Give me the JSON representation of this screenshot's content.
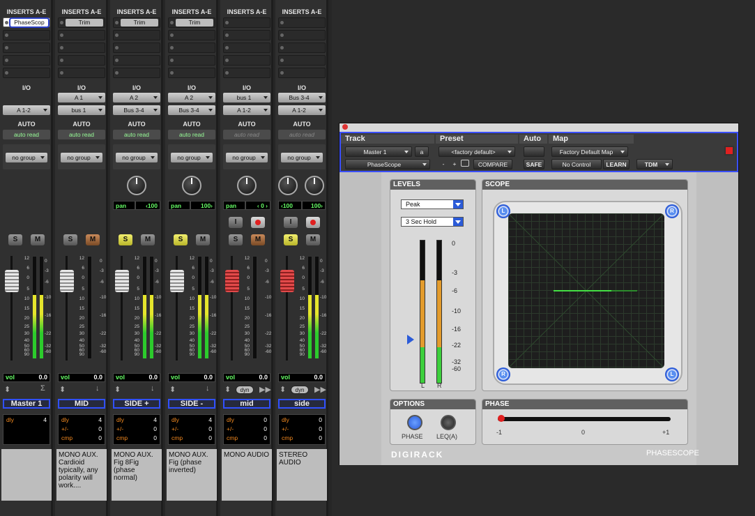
{
  "mixer": {
    "inserts_header": "INSERTS A-E",
    "io_header": "I/O",
    "auto_header": "AUTO",
    "vol_label": "vol",
    "dly_label": "dly",
    "pm_label": "+/-",
    "cmp_label": "cmp",
    "strips": [
      {
        "insert": "PhaseScop",
        "io_in": "",
        "io_out": "A 1-2",
        "auto": "auto read",
        "group": "no group",
        "vol": "0.0",
        "name": "Master 1",
        "dly": "4",
        "pm": "",
        "cmp": "",
        "comment": ""
      },
      {
        "insert": "Trim",
        "io_in": "A 1",
        "io_out": "bus 1",
        "auto": "auto read",
        "group": "no group",
        "vol": "0.0",
        "name": "MID",
        "dly": "4",
        "pm": "0",
        "cmp": "0",
        "comment": "MONO AUX. Cardioid typically, any polarity will work...."
      },
      {
        "insert": "Trim",
        "io_in": "A 2",
        "io_out": "Bus 3-4",
        "auto": "auto read",
        "group": "no group",
        "vol": "0.0",
        "name": "SIDE +",
        "pan": "pan",
        "pan_val": "‹100",
        "dly": "4",
        "pm": "0",
        "cmp": "0",
        "comment": "MONO AUX. Fig 8Fig (phase normal)"
      },
      {
        "insert": "Trim",
        "io_in": "A 2",
        "io_out": "Bus 3-4",
        "auto": "auto read",
        "group": "no group",
        "vol": "0.0",
        "name": "SIDE -",
        "pan": "pan",
        "pan_val": "100›",
        "dly": "4",
        "pm": "0",
        "cmp": "0",
        "comment": "MONO AUX. Fig (phase inverted)"
      },
      {
        "insert": "",
        "io_in": "bus 1",
        "io_out": "A 1-2",
        "auto": "auto read",
        "group": "no group",
        "vol": "0.0",
        "name": "mid",
        "pan": "pan",
        "pan_val": "‹ 0 ›",
        "dyn": "dyn",
        "dly": "0",
        "pm": "0",
        "cmp": "0",
        "comment": "MONO AUDIO"
      },
      {
        "insert": "",
        "io_in": "Bus 3-4",
        "io_out": "A 1-2",
        "auto": "auto read",
        "group": "no group",
        "vol": "0.0",
        "name": "side",
        "pan_l": "‹100",
        "pan_r": "100›",
        "dyn": "dyn",
        "dly": "0",
        "pm": "0",
        "cmp": "0",
        "comment": "STEREO AUDIO"
      }
    ],
    "fader_scale": [
      "12",
      "6",
      "0",
      "5",
      "10",
      "15",
      "20",
      "25",
      "30",
      "40",
      "50",
      "60",
      "90"
    ],
    "meter_scale": [
      "0",
      "-3",
      "-6",
      "-10",
      "-16",
      "-22",
      "-32",
      "-60"
    ]
  },
  "plugin": {
    "track_label": "Track",
    "preset_label": "Preset",
    "auto_label": "Auto",
    "map_label": "Map",
    "track_name": "Master 1",
    "track_chan": "a",
    "plugin_name": "PhaseScope",
    "preset_value": "<factory default>",
    "minus": "-",
    "plus": "+",
    "compare": "COMPARE",
    "safe": "SAFE",
    "map_value": "Factory Default Map",
    "control": "No Control",
    "learn": "LEARN",
    "tdm": "TDM",
    "levels_title": "LEVELS",
    "scope_title": "SCOPE",
    "options_title": "OPTIONS",
    "phase_title": "PHASE",
    "peak_select": "Peak",
    "hold_select": "3 Sec Hold",
    "level_scale": [
      "0",
      "-3",
      "-6",
      "-10",
      "-16",
      "-22",
      "-32",
      "-60"
    ],
    "l": "L",
    "r": "R",
    "phase_btn": "PHASE",
    "leq_btn": "LEQ(A)",
    "phase_scale": [
      "-1",
      "0",
      "+1"
    ],
    "brand": "DIGIRACK",
    "product": "PHASESCOPE"
  }
}
